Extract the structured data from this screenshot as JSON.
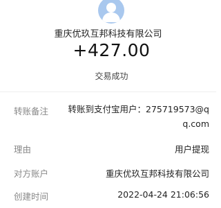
{
  "header": {
    "avatar_icon": "user-avatar-icon",
    "company": "重庆优玖互邦科技有限公司",
    "amount": "+427.00",
    "status": "交易成功"
  },
  "details": [
    {
      "label": "转账备注",
      "value_line1": "转账到支付宝用户：275719573@q",
      "value_line2": "q.com"
    },
    {
      "label": "理由",
      "value": "用户提现"
    },
    {
      "label": "对方账户",
      "value": "重庆优玖互邦科技有限公司"
    },
    {
      "label": "创建时间",
      "value": "2022-04-24 21:06:56"
    }
  ]
}
